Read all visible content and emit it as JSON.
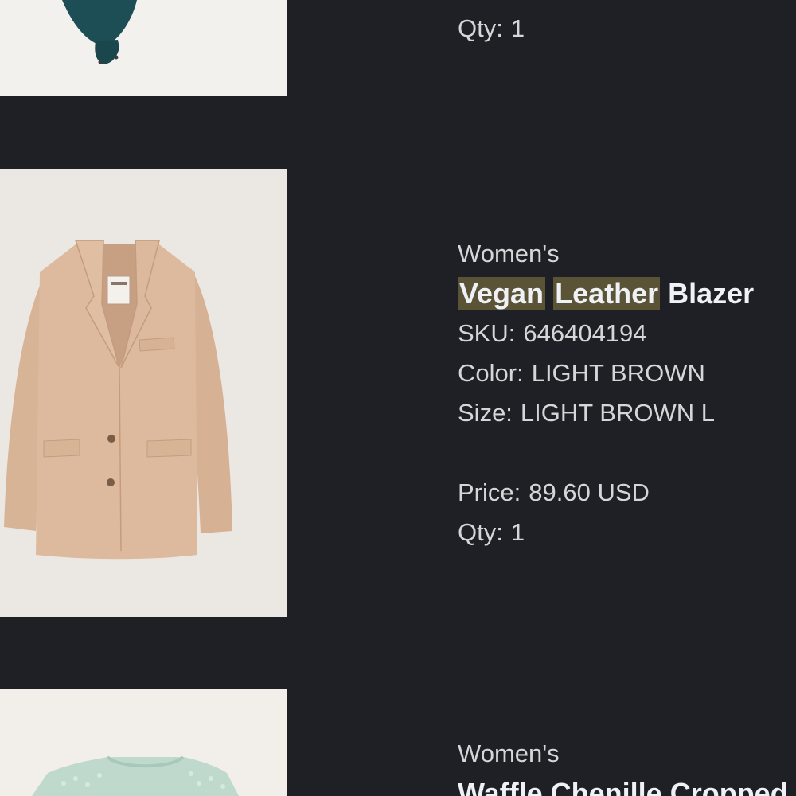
{
  "items": [
    {
      "qty_label": "Qty:",
      "qty": "1",
      "image_icon": "teal-bodysuit-image"
    },
    {
      "category": "Women's",
      "title_words": [
        "Vegan",
        "Leather",
        "Blazer"
      ],
      "sku_label": "SKU:",
      "sku": "646404194",
      "color_label": "Color:",
      "color": "LIGHT BROWN",
      "size_label": "Size:",
      "size": "LIGHT BROWN L",
      "price_label": "Price:",
      "price": "89.60 USD",
      "qty_label": "Qty:",
      "qty": "1",
      "image_icon": "light-brown-blazer-image"
    },
    {
      "category": "Women's",
      "title": "Waffle Chenille Cropped",
      "image_icon": "mint-sweater-image"
    }
  ],
  "colors": {
    "background": "#1f2025",
    "text": "#d6d6d8",
    "title": "#eef1f6",
    "highlight": "#5b5336"
  }
}
